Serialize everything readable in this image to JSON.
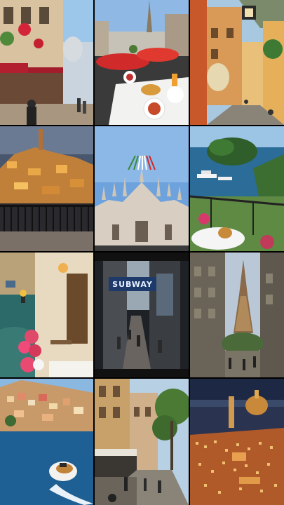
{
  "collage": {
    "columns": 3,
    "rows": 4,
    "tiles": [
      {
        "subject": "cafe-street-with-red-flowers"
      },
      {
        "subject": "breakfast-balcony-eiffel-tower"
      },
      {
        "subject": "cobblestone-alley-with-lantern"
      },
      {
        "subject": "hilltop-town-at-dusk"
      },
      {
        "subject": "milan-cathedral-flyover"
      },
      {
        "subject": "coastal-island-yachts"
      },
      {
        "subject": "venice-canal-with-flower-pots"
      },
      {
        "subject": "subway-sign-street"
      },
      {
        "subject": "eiffel-tower-street"
      },
      {
        "subject": "amalfi-coast-boat"
      },
      {
        "subject": "shopping-street-trees"
      },
      {
        "subject": "florence-night-skyline"
      }
    ]
  },
  "signage": {
    "subway_label": "SUBWAY"
  },
  "colors": {
    "background": "#000000",
    "sky": "#6fa8dc",
    "dusk": "#1d2640",
    "sea": "#1e5d8a"
  }
}
